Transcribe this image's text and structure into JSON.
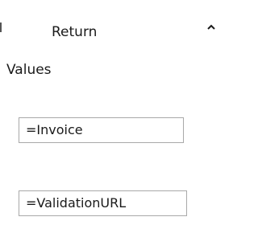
{
  "section": {
    "header": "Return",
    "sub_header": "Values",
    "collapse_icon": "chevron-up-icon"
  },
  "fields": [
    {
      "value": "=Invoice"
    },
    {
      "value": "=ValidationURL"
    }
  ]
}
